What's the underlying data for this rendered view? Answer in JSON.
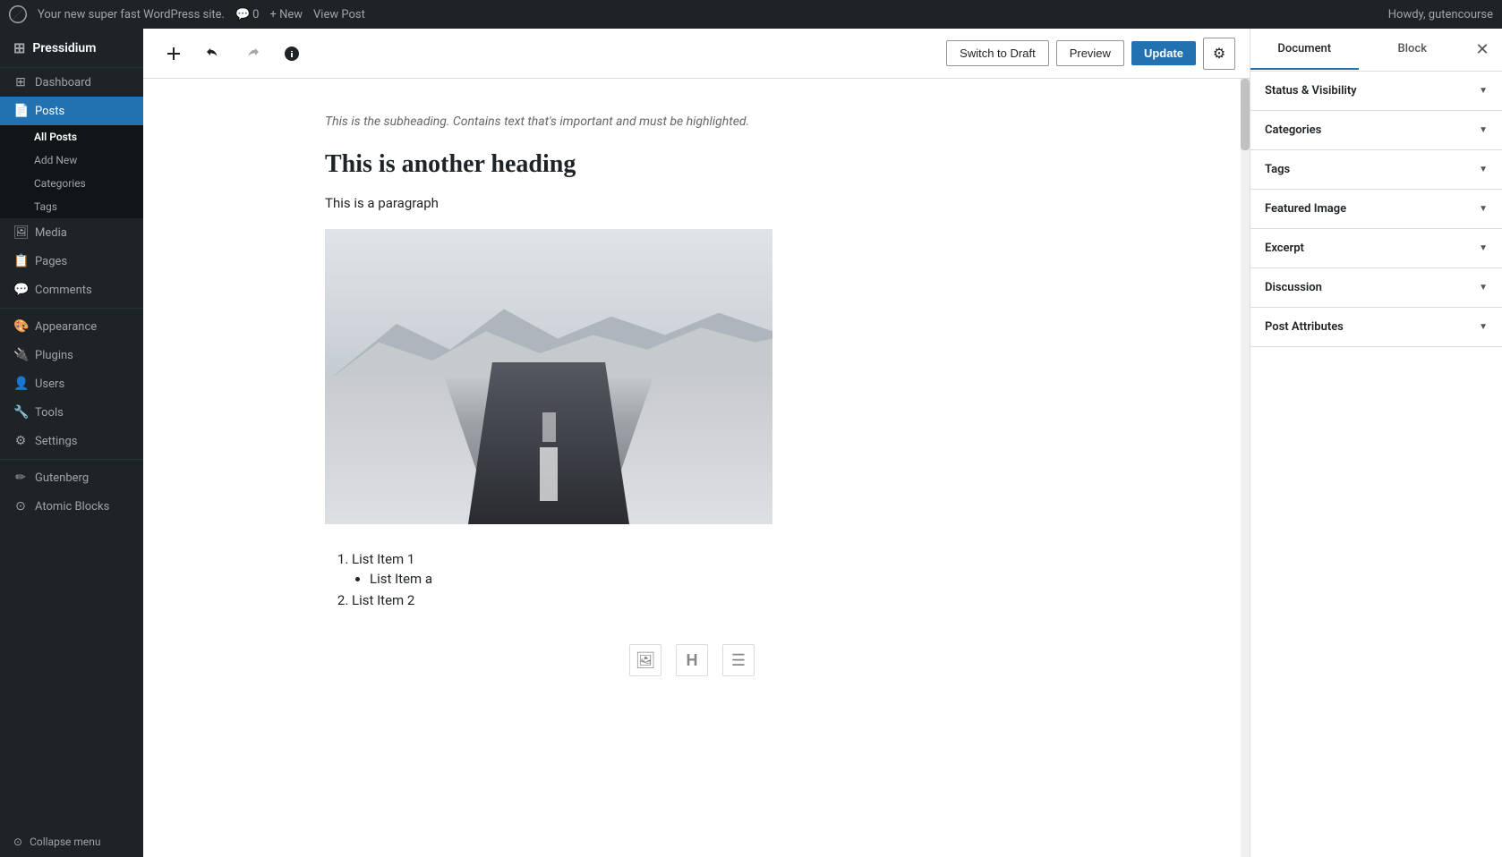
{
  "adminbar": {
    "logo_alt": "WordPress",
    "site_name": "Your new super fast WordPress site.",
    "comments_icon": "💬",
    "comments_count": "0",
    "new_label": "+ New",
    "view_post_label": "View Post",
    "howdy": "Howdy, gutencourse"
  },
  "sidebar": {
    "brand": "Pressidium",
    "menu_items": [
      {
        "id": "dashboard",
        "label": "Dashboard",
        "icon": "⊞"
      },
      {
        "id": "posts",
        "label": "Posts",
        "icon": "📄",
        "active": true,
        "subitems": [
          {
            "id": "all-posts",
            "label": "All Posts",
            "active": true
          },
          {
            "id": "add-new",
            "label": "Add New"
          },
          {
            "id": "categories",
            "label": "Categories"
          },
          {
            "id": "tags",
            "label": "Tags"
          }
        ]
      },
      {
        "id": "media",
        "label": "Media",
        "icon": "🖼"
      },
      {
        "id": "pages",
        "label": "Pages",
        "icon": "📋"
      },
      {
        "id": "comments",
        "label": "Comments",
        "icon": "💬"
      },
      {
        "id": "appearance",
        "label": "Appearance",
        "icon": "🎨"
      },
      {
        "id": "plugins",
        "label": "Plugins",
        "icon": "🔌"
      },
      {
        "id": "users",
        "label": "Users",
        "icon": "👤"
      },
      {
        "id": "tools",
        "label": "Tools",
        "icon": "🔧"
      },
      {
        "id": "settings",
        "label": "Settings",
        "icon": "⚙"
      },
      {
        "id": "gutenberg",
        "label": "Gutenberg",
        "icon": "✏"
      },
      {
        "id": "atomic-blocks",
        "label": "Atomic Blocks",
        "icon": "⊙"
      }
    ],
    "collapse_label": "Collapse menu"
  },
  "toolbar": {
    "add_block_tooltip": "Add block",
    "undo_tooltip": "Undo",
    "redo_tooltip": "Redo",
    "info_tooltip": "Block information",
    "switch_draft_label": "Switch to Draft",
    "preview_label": "Preview",
    "update_label": "Update",
    "settings_icon": "⚙"
  },
  "editor": {
    "subheading": "This is the subheading. Contains text that's important and must be highlighted.",
    "heading": "This is another heading",
    "paragraph": "This is a paragraph",
    "list_items": [
      {
        "text": "List Item 1",
        "subitems": [
          "List Item a"
        ]
      },
      {
        "text": "List Item 2",
        "subitems": []
      }
    ]
  },
  "right_panel": {
    "document_tab": "Document",
    "block_tab": "Block",
    "close_icon": "✕",
    "sections": [
      {
        "id": "status-visibility",
        "label": "Status & Visibility"
      },
      {
        "id": "categories",
        "label": "Categories"
      },
      {
        "id": "tags",
        "label": "Tags"
      },
      {
        "id": "featured-image",
        "label": "Featured Image"
      },
      {
        "id": "excerpt",
        "label": "Excerpt"
      },
      {
        "id": "discussion",
        "label": "Discussion"
      },
      {
        "id": "post-attributes",
        "label": "Post Attributes"
      }
    ]
  }
}
